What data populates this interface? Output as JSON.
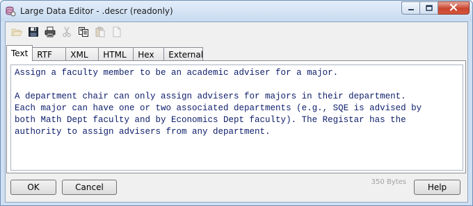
{
  "window": {
    "title": "Large Data Editor - .descr (readonly)"
  },
  "toolbar": {
    "buttons": [
      {
        "name": "open",
        "icon": "folder-open-icon",
        "enabled": false
      },
      {
        "name": "save",
        "icon": "floppy-disk-icon",
        "enabled": true
      },
      {
        "name": "print",
        "icon": "printer-icon",
        "enabled": true
      },
      {
        "name": "cut",
        "icon": "scissors-icon",
        "enabled": false
      },
      {
        "name": "copy",
        "icon": "copy-icon",
        "enabled": true
      },
      {
        "name": "paste",
        "icon": "clipboard-icon",
        "enabled": false
      },
      {
        "name": "clear",
        "icon": "page-icon",
        "enabled": false
      }
    ]
  },
  "tabs": [
    {
      "label": "Text",
      "active": true
    },
    {
      "label": "RTF",
      "active": false
    },
    {
      "label": "XML",
      "active": false
    },
    {
      "label": "HTML",
      "active": false
    },
    {
      "label": "Hex",
      "active": false
    },
    {
      "label": "External",
      "active": false
    }
  ],
  "editor": {
    "text": "Assign a faculty member to be an academic adviser for a major.\n\nA department chair can only assign advisers for majors in their department.\nEach major can have one or two associated departments (e.g., SQE is advised by\nboth Math Dept faculty and by Economics Dept faculty). The Registar has the\nauthority to assign advisers from any department.",
    "text_color": "#0c1c6a"
  },
  "footer": {
    "ok_label": "OK",
    "cancel_label": "Cancel",
    "size_label": "350 Bytes",
    "help_label": "Help"
  }
}
